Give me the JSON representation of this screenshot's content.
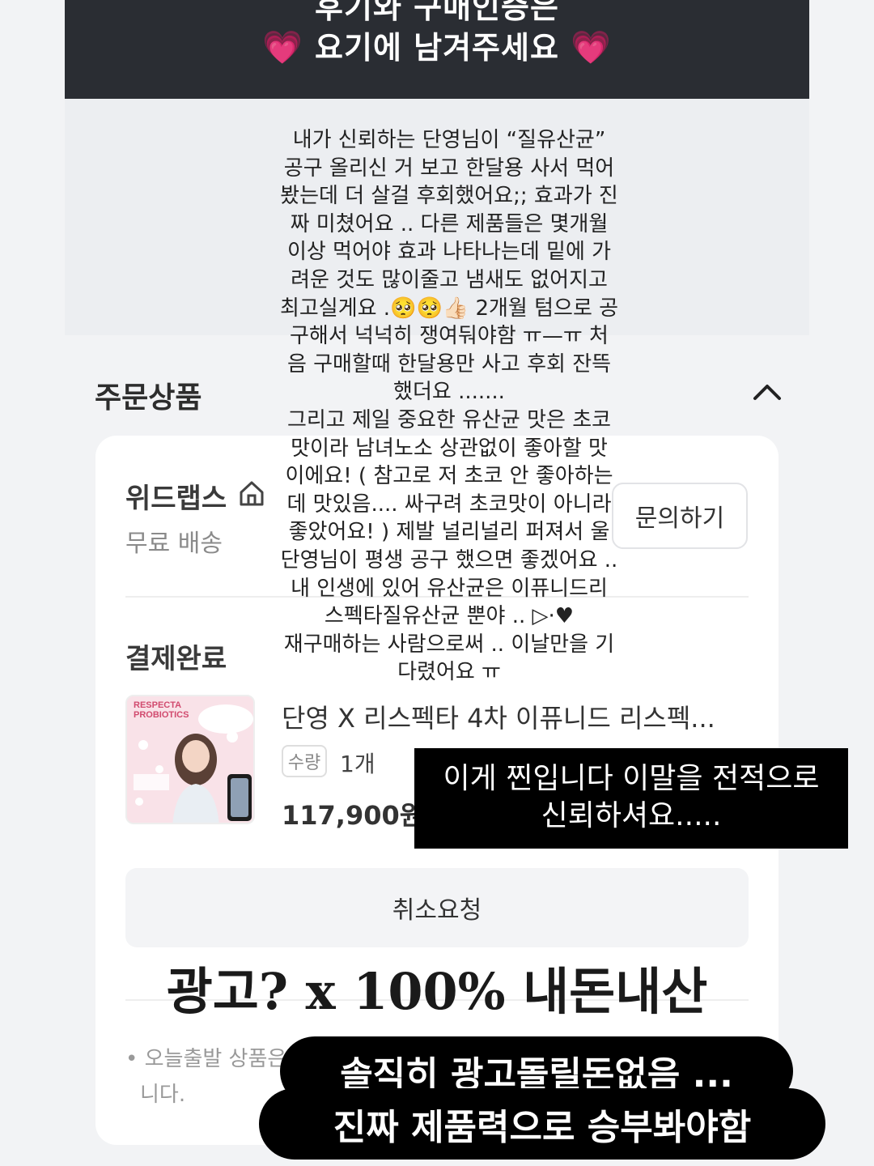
{
  "banner": {
    "line1": "후기와 구매인증은",
    "line2": "요기에 남겨주세요",
    "heart_icon": "💗"
  },
  "order": {
    "section_title": "주문상품",
    "seller_name": "위드랩스",
    "shipping": "무료 배송",
    "inquiry_label": "문의하기",
    "payment_status": "결제완료",
    "product_name": "단영 X 리스펙타 4차 이퓨니드 리스펙...",
    "qty_label": "수량",
    "qty_value": "1개",
    "price": "117,900원",
    "cancel_label": "취소요청",
    "notice_line1": "오늘출발 상품은",
    "notice_line2": "니다."
  },
  "thumbnail": {
    "brand_line1": "RESPECTA",
    "brand_line2": "PROBIOTICS"
  },
  "story": {
    "review": "내가 신뢰하는 단영님이 “질유산균”\n공구 올리신 거 보고 한달용 사서 먹어\n봤는데 더 살걸 후회했어요;; 효과가 진\n짜 미쳤어요 .. 다른 제품들은 몇개월\n이상 먹어야 효과 나타나는데 밑에 가\n려운 것도 많이줄고 냄새도 없어지고\n최고실게요 .🥺🥺👍🏻 2개월 텀으로 공\n구해서 넉넉히 쟁여둬야함 ㅠ—ㅠ 처\n음 구매할때 한달용만 사고 후회 잔뜩\n했더요 .......\n그리고 제일 중요한 유산균 맛은 초코\n맛이라 남녀노소 상관없이 좋아할 맛\n이에요! ( 참고로 저 초코 안 좋아하는\n데 맛있음.... 싸구려 초코맛이 아니라\n좋았어요! ) 제발 널리널리 퍼져서 울\n단영님이 평생 공구 했으면 좋겠어요 ..\n내 인생에 있어 유산균은 이퓨니드리\n스펙타질유산균 뿐야 .. ▷·♥\n재구매하는 사람으로써 .. 이날만을 기\n다렸어요 ㅠ",
    "caption_line1": "이게 찐입니다 이말을 전적으로",
    "caption_line2": "신뢰하셔요.....",
    "ad_line": "광고? x 100% 내돈내산",
    "pill1": "솔직히 광고돌릴돈없음 ...",
    "pill2": "진짜 제품력으로 승부봐야함"
  },
  "colors": {
    "banner_bg": "#2a2d33",
    "page_bg": "#f2f3f5",
    "card_bg": "#ffffff",
    "heart": "#ff5fa8"
  }
}
